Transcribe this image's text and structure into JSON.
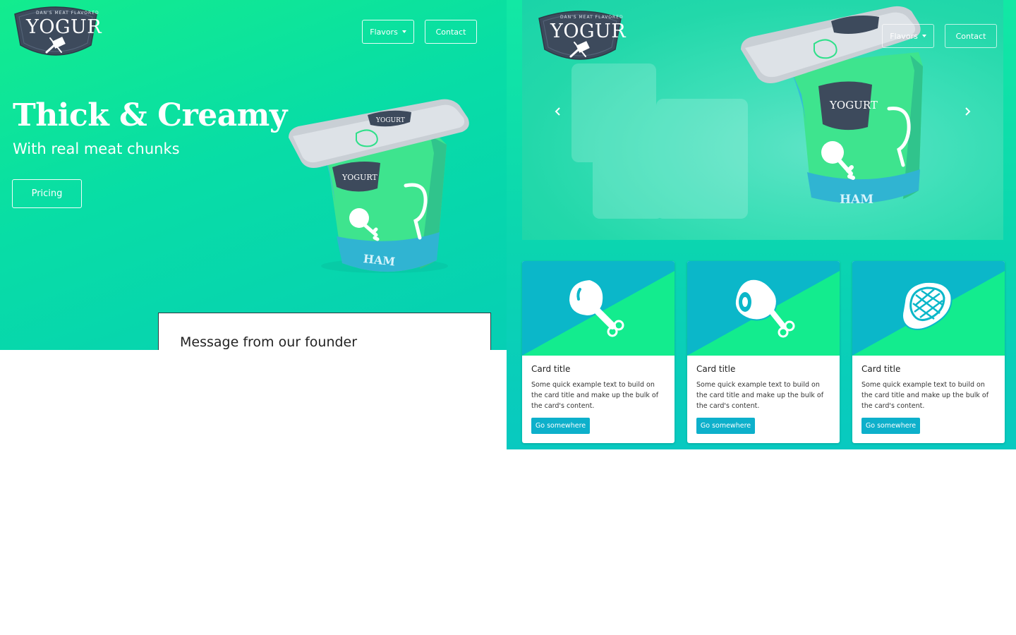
{
  "left": {
    "logo": {
      "wordmark": "YOGUR",
      "tagline": "Dan's meat flavored",
      "icon": "cleaver-icon"
    },
    "nav": {
      "flavors_label": "Flavors",
      "contact_label": "Contact"
    },
    "hero": {
      "title": "Thick & Creamy",
      "subtitle": "With real meat chunks",
      "pricing_label": "Pricing"
    },
    "product": {
      "lid_brand": "YOGURT",
      "flavor": "HAM"
    },
    "founder": {
      "heading": "Message from our founder"
    }
  },
  "right": {
    "logo": {
      "wordmark": "YOGUR",
      "tagline": "Dan's meat flavored"
    },
    "nav": {
      "flavors_label": "Flavors",
      "contact_label": "Contact"
    },
    "carousel": {
      "product_brand": "YOGURT",
      "product_flavor": "HAM",
      "prev_icon": "chevron-left-icon",
      "next_icon": "chevron-right-icon"
    },
    "cards": [
      {
        "icon": "drumstick-icon",
        "title": "Card title",
        "text": "Some quick example text to build on the card title and make up the bulk of the card's content.",
        "button": "Go somewhere"
      },
      {
        "icon": "ham-icon",
        "title": "Card title",
        "text": "Some quick example text to build on the card title and make up the bulk of the card's content.",
        "button": "Go somewhere"
      },
      {
        "icon": "steak-icon",
        "title": "Card title",
        "text": "Some quick example text to build on the card title and make up the bulk of the card's content.",
        "button": "Go somewhere"
      }
    ]
  },
  "colors": {
    "brand_green": "#13ec8e",
    "brand_teal": "#08c9c0",
    "card_blue": "#0bb7c9",
    "button_blue": "#0db0cb",
    "logo_navy": "#3d4a5c"
  }
}
